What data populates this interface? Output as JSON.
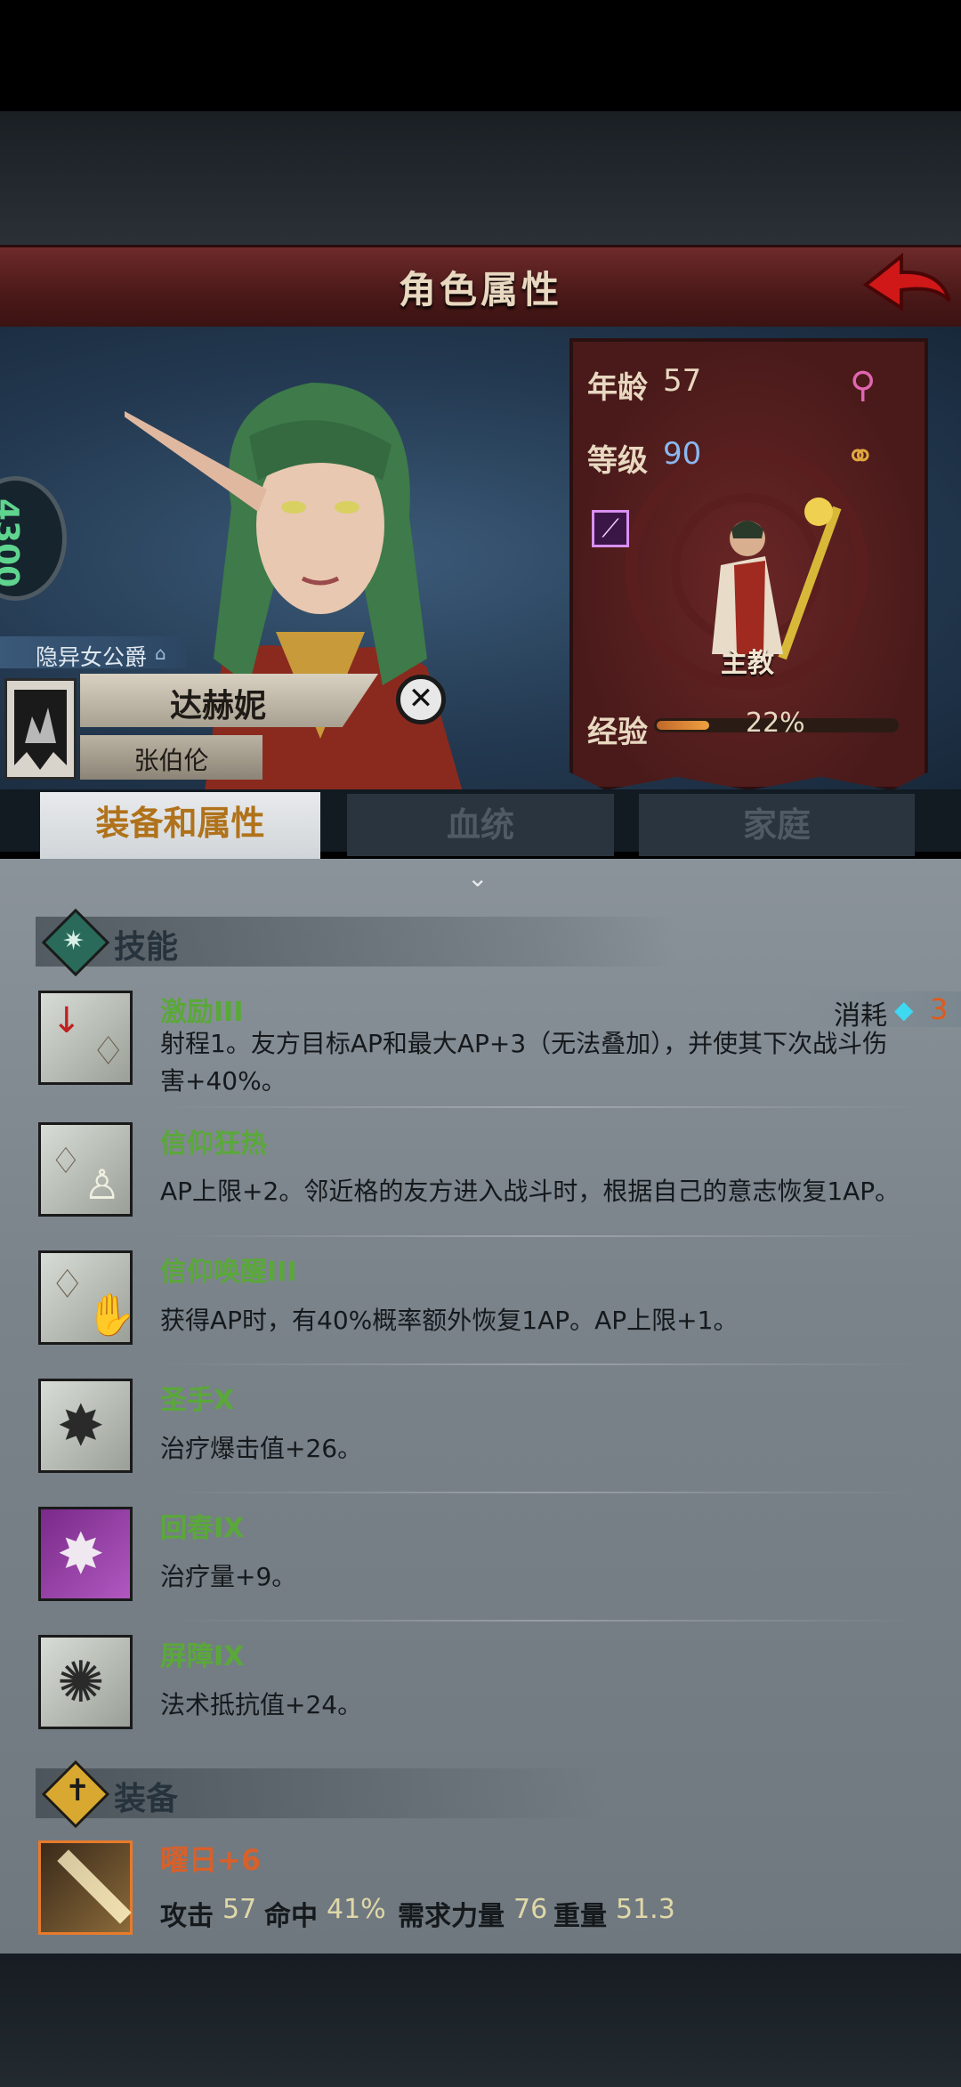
{
  "header": {
    "title": "角色属性"
  },
  "character": {
    "level_badge": "4300",
    "title_tag": "隐异女公爵",
    "name": "达赫妮",
    "surname": "张伯伦"
  },
  "stats": {
    "age_label": "年龄",
    "age_value": "57",
    "level_label": "等级",
    "level_value": "90",
    "class_name": "主教",
    "exp_label": "经验",
    "exp_value": "22%",
    "exp_fraction": 0.22
  },
  "tabs": [
    {
      "label": "装备和属性",
      "active": true
    },
    {
      "label": "血统",
      "active": false
    },
    {
      "label": "家庭",
      "active": false
    }
  ],
  "skills_section": {
    "title": "技能",
    "cost_label": "消耗",
    "cost_value": "3"
  },
  "skills": [
    {
      "name": "激励III",
      "desc": "射程1。友方目标AP和最大AP+3（无法叠加），并使其下次战斗伤害+40%。",
      "icon": "inspire-icon"
    },
    {
      "name": "信仰狂热",
      "desc": "AP上限+2。邻近格的友方进入战斗时，根据自己的意志恢复1AP。",
      "icon": "faith-zeal-icon"
    },
    {
      "name": "信仰唤醒III",
      "desc": "获得AP时，有40%概率额外恢复1AP。AP上限+1。",
      "icon": "faith-awaken-icon"
    },
    {
      "name": "圣手X",
      "desc": "治疗爆击值+26。",
      "icon": "holy-hand-icon"
    },
    {
      "name": "回春IX",
      "desc": "治疗量+9。",
      "icon": "rejuvenate-icon"
    },
    {
      "name": "屏障IX",
      "desc": "法术抵抗值+24。",
      "icon": "barrier-icon"
    }
  ],
  "equipment_section": {
    "title": "装备"
  },
  "equipment": {
    "name": "曜日+6",
    "attack_label": "攻击",
    "attack_value": "57",
    "hit_label": "命中",
    "hit_value": "41%",
    "str_label": "需求力量",
    "str_value": "76",
    "weight_label": "重量",
    "weight_value": "51.3"
  },
  "colors": {
    "accent_green": "#5aa83a",
    "accent_orange": "#d8602a",
    "banner_red": "#6e2a2a"
  }
}
